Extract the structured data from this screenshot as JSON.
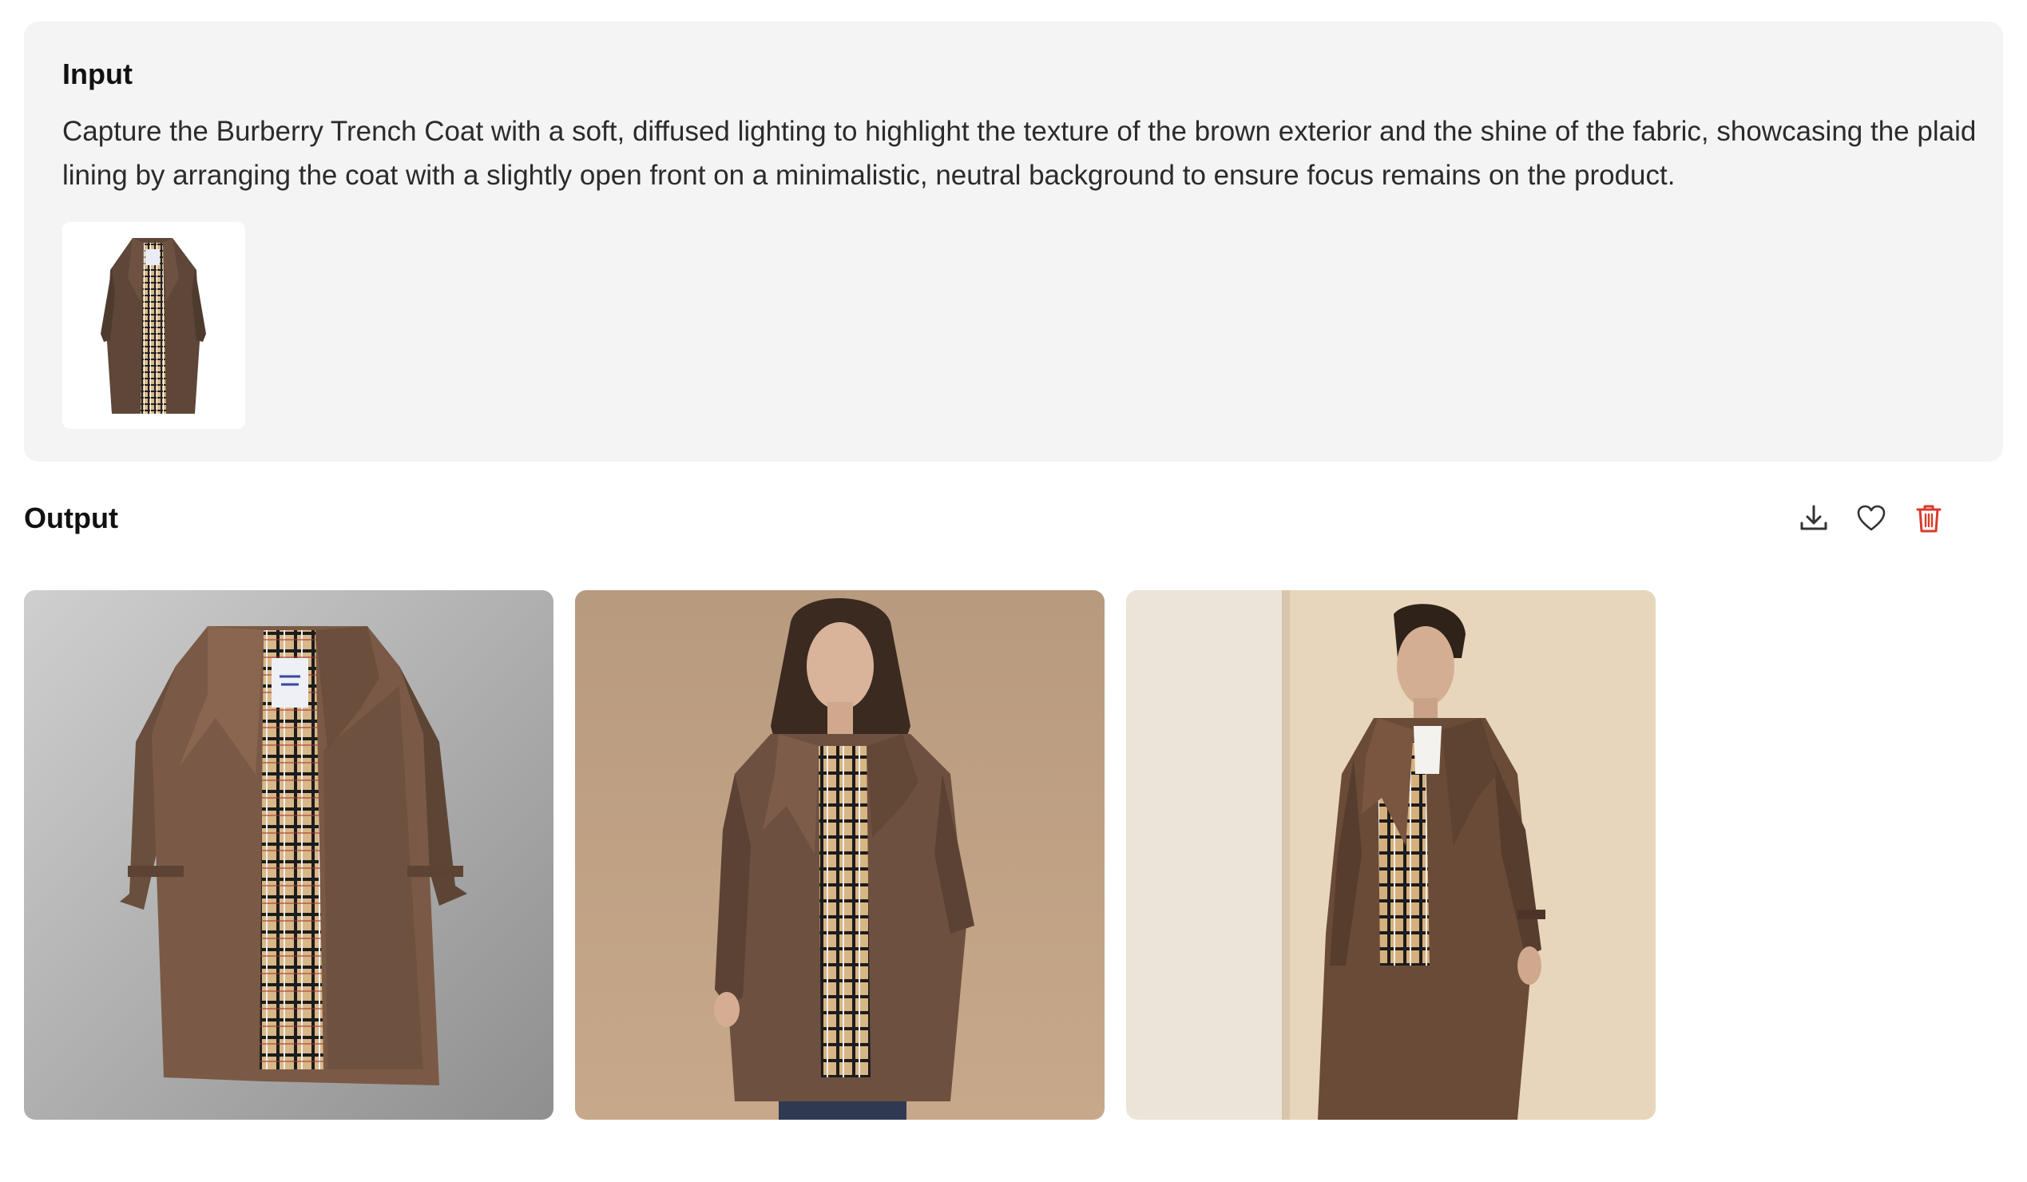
{
  "input": {
    "title": "Input",
    "prompt": "Capture the Burberry Trench Coat with a soft, diffused lighting to highlight the texture of the brown exterior and the shine of the fabric, showcasing the plaid lining by arranging the coat with a slightly open front on a minimalistic, neutral background to ensure focus remains on the product.",
    "reference_image": "trench-coat-reference"
  },
  "output": {
    "title": "Output",
    "actions": {
      "download": "download-icon",
      "favorite": "heart-icon",
      "delete": "trash-icon"
    },
    "images": [
      {
        "subject": "trench-coat-flat-lay"
      },
      {
        "subject": "woman-in-trench-coat"
      },
      {
        "subject": "man-in-trench-coat"
      }
    ]
  },
  "colors": {
    "panel_bg": "#f4f4f4",
    "delete_red": "#d93a2b",
    "icon_dark": "#333333",
    "coat_brown": "#6e5241"
  }
}
